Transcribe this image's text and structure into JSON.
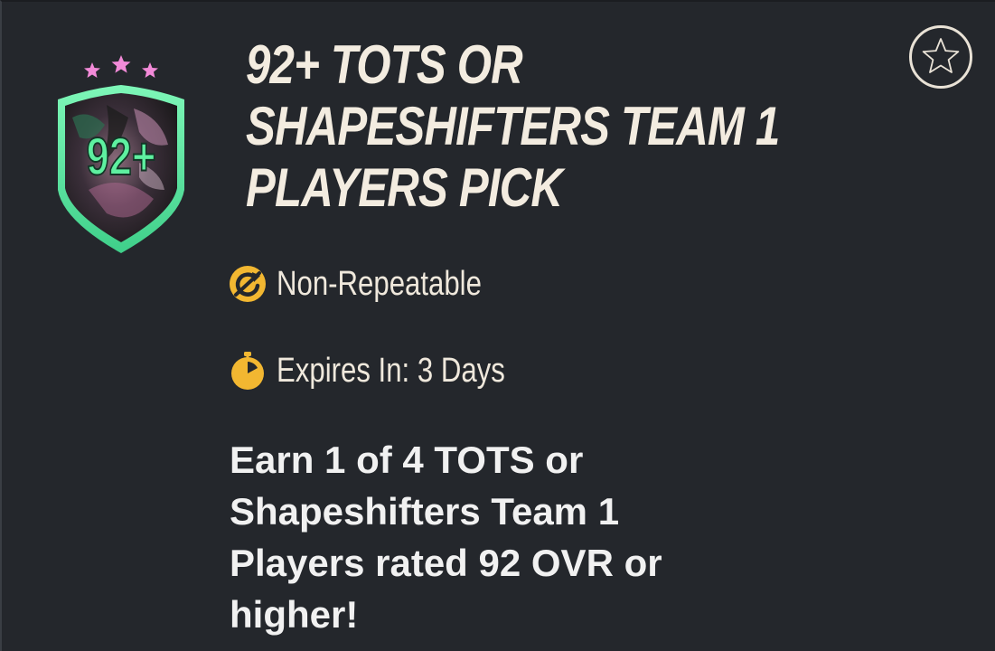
{
  "header": {
    "title_lines": [
      "92+ TOTS OR",
      "SHAPESHIFTERS TEAM 1",
      "PLAYERS PICK"
    ]
  },
  "badge": {
    "rating_label": "92+",
    "stars_count": 3,
    "icon": "shield-badge-icon"
  },
  "meta": {
    "repeatability": "Non-Repeatable",
    "repeatability_icon": "refresh-icon",
    "expiry": "Expires In: 3 Days",
    "expiry_icon": "stopwatch-icon"
  },
  "description": {
    "lines": [
      "Earn 1 of 4 TOTS or",
      "Shapeshifters Team 1",
      "Players rated 92 OVR or",
      "higher!"
    ]
  },
  "favorite": {
    "icon": "star-icon"
  },
  "colors": {
    "background": "#24272c",
    "title": "#f3ece0",
    "accent_gold": "#f2b731",
    "badge_green": "#5ef0a0",
    "badge_stars": "#f28ad8"
  }
}
